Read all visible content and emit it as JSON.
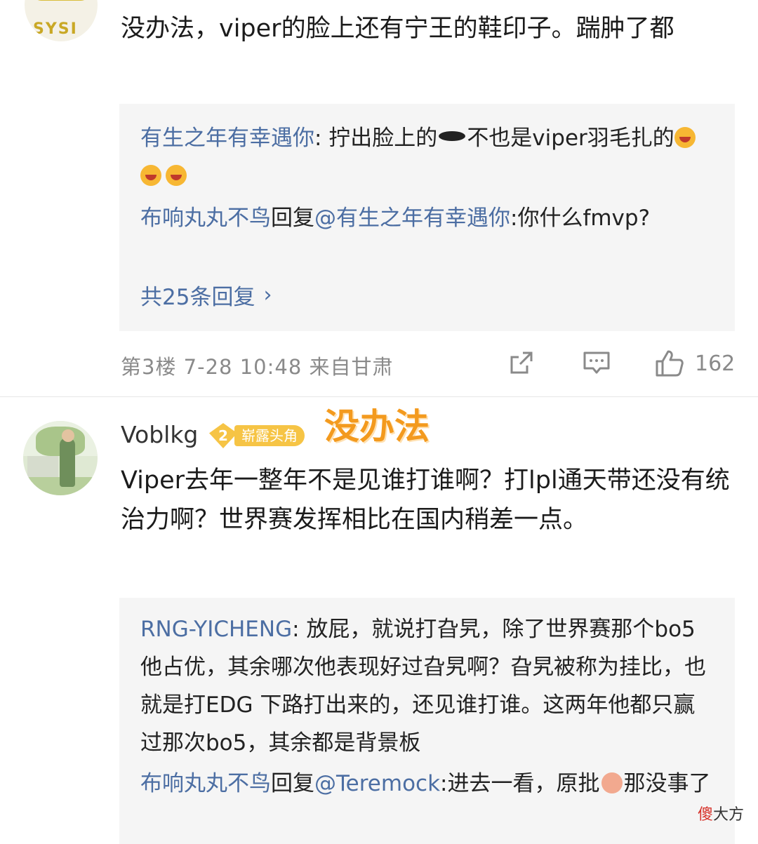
{
  "comment1": {
    "avatar_text": "SYSI",
    "text": "没办法，viper的脸上还有宁王的鞋印子。踹肿了都",
    "replies": [
      {
        "user": "有生之年有幸遇你",
        "sep": ":",
        "text_a": " 拧出脸上的",
        "text_b": "不也是viper羽毛扎的"
      },
      {
        "user": "布响丸丸不鸟",
        "reply_word": "回复",
        "target": "@有生之年有幸遇你",
        "text": ":你什么fmvp?"
      }
    ],
    "more_replies": "共25条回复",
    "meta": "第3楼  7-28  10:48  来自甘肃",
    "likes": "162"
  },
  "comment2": {
    "username": "Voblkg",
    "badge_level": "2",
    "badge_label": "崭露头角",
    "overlay_caption": "没办法",
    "text": "Viper去年一整年不是见谁打谁啊？打lpl通天带还没有统治力啊？世界赛发挥相比在国内稍差一点。",
    "replies": [
      {
        "user": "RNG-YICHENG",
        "text": ": 放屁，就说打旮旯，除了世界赛那个bo5他占优，其余哪次他表现好过旮旯啊？旮旯被称为挂比，也就是打EDG 下路打出来的，还见谁打谁。这两年他都只赢过那次bo5，其余都是背景板"
      },
      {
        "user": "布响丸丸不鸟",
        "reply_word": "回复",
        "target": "@Teremock",
        "text_a": ":进去一看，原批",
        "text_b": "那没事了"
      }
    ]
  },
  "watermark": {
    "part1": "傻",
    "part2": "大方"
  }
}
